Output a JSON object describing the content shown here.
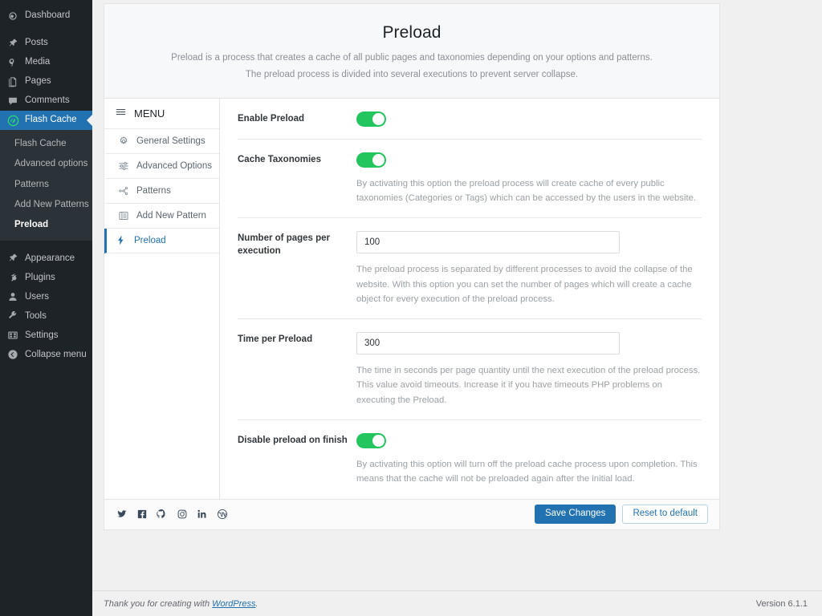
{
  "admin_sidebar": {
    "items": [
      {
        "label": "Dashboard",
        "icon": "dashboard-icon"
      },
      {
        "label": "Posts",
        "icon": "pin-icon"
      },
      {
        "label": "Media",
        "icon": "media-icon"
      },
      {
        "label": "Pages",
        "icon": "pages-icon"
      },
      {
        "label": "Comments",
        "icon": "comments-icon"
      },
      {
        "label": "Flash Cache",
        "icon": "leaf-icon"
      },
      {
        "label": "Appearance",
        "icon": "brush-icon"
      },
      {
        "label": "Plugins",
        "icon": "plug-icon"
      },
      {
        "label": "Users",
        "icon": "user-icon"
      },
      {
        "label": "Tools",
        "icon": "wrench-icon"
      },
      {
        "label": "Settings",
        "icon": "sliders-icon"
      },
      {
        "label": "Collapse menu",
        "icon": "collapse-icon"
      }
    ],
    "active_item": "Flash Cache",
    "submenu": [
      {
        "label": "Flash Cache"
      },
      {
        "label": "Advanced options"
      },
      {
        "label": "Patterns"
      },
      {
        "label": "Add New Patterns"
      },
      {
        "label": "Preload"
      }
    ],
    "submenu_current": "Preload",
    "active_bg_color": "#2271b1",
    "sidebar_bg_color": "#1d2327",
    "submenu_bg_color": "#2c3338"
  },
  "card": {
    "header": {
      "title": "Preload",
      "subtitle_line1": "Preload is a process that creates a cache of all public pages and taxonomies depending on your options and patterns.",
      "subtitle_line2": "The preload process is divided into several executions to prevent server collapse."
    },
    "panel_menu": {
      "heading": "MENU",
      "heading_icon": "hamburger-icon",
      "items": [
        {
          "label": "General Settings",
          "icon": "gear-icon",
          "active": false
        },
        {
          "label": "Advanced Options",
          "icon": "sliders-icon",
          "active": false
        },
        {
          "label": "Patterns",
          "icon": "node-graph-icon",
          "active": false
        },
        {
          "label": "Add New Pattern",
          "icon": "list-box-icon",
          "active": false
        },
        {
          "label": "Preload",
          "icon": "lightning-bolt-icon",
          "active": true
        }
      ],
      "active_color": "#2271b1"
    },
    "settings": [
      {
        "label": "Enable Preload",
        "control": "toggle",
        "value": "on",
        "description": ""
      },
      {
        "label": "Cache Taxonomies",
        "control": "toggle",
        "value": "on",
        "description": "By activating this option the preload process will create cache of every public taxonomies (Categories or Tags) which can be accessed by the users in the website."
      },
      {
        "label": "Number of pages per execution",
        "control": "text",
        "value": "100",
        "placeholder": "",
        "description": "The preload process is separated by different processes to avoid the collapse of the website. With this option you can set the number of pages which will create a cache object for every execution of the preload process."
      },
      {
        "label": "Time per Preload",
        "control": "text",
        "value": "300",
        "placeholder": "",
        "description": "The time in seconds per page quantity until the next execution of the preload process. This value avoid timeouts. Increase it if you have timeouts PHP problems on executing the Preload."
      },
      {
        "label": "Disable preload on finish",
        "control": "toggle",
        "value": "on",
        "description": "By activating this option will turn off the preload cache process upon completion. This means that the cache will not be preloaded again after the initial load."
      }
    ],
    "footer": {
      "social": [
        {
          "name": "twitter-icon"
        },
        {
          "name": "facebook-icon"
        },
        {
          "name": "github-icon"
        },
        {
          "name": "instagram-icon"
        },
        {
          "name": "linkedin-icon"
        },
        {
          "name": "wordpress-icon"
        }
      ],
      "save_label": "Save Changes",
      "reset_label": "Reset to default",
      "save_color": "#2271b1"
    }
  },
  "page_footer": {
    "thanks_prefix": "Thank you for creating with ",
    "wordpress_link": "WordPress",
    "thanks_suffix": ".",
    "version": "Version 6.1.1"
  },
  "toggle_on_color": "#22c55e"
}
